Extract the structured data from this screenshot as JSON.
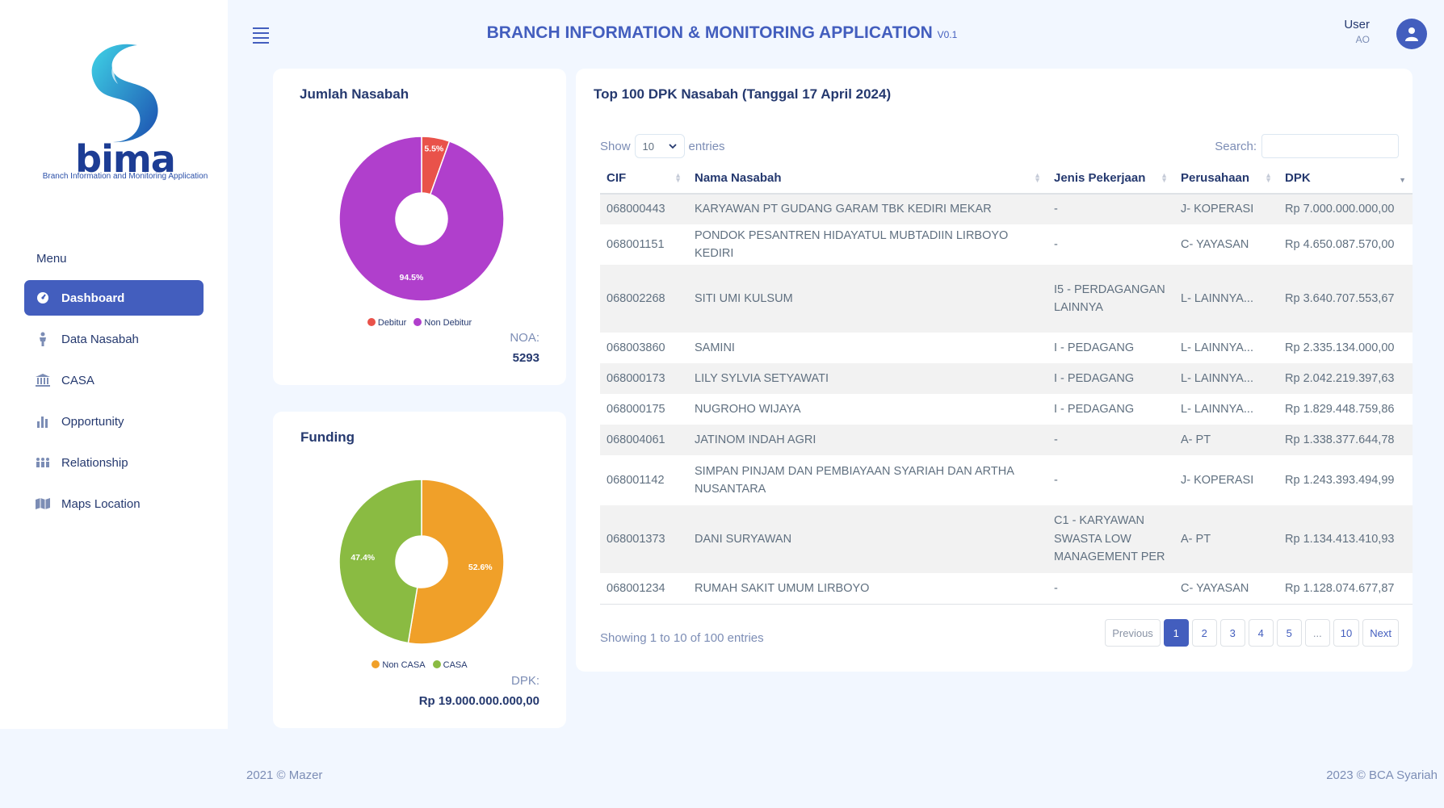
{
  "app": {
    "title": "BRANCH INFORMATION & MONITORING APPLICATION",
    "version": "V0.1"
  },
  "logo": {
    "word": "bima",
    "subtitle": "Branch Information and Monitoring Application"
  },
  "user": {
    "name": "User",
    "role": "AO"
  },
  "sidebar": {
    "menu_title": "Menu",
    "items": [
      {
        "label": "Dashboard",
        "icon": "dashboard-icon",
        "active": true
      },
      {
        "label": "Data Nasabah",
        "icon": "person-icon",
        "active": false
      },
      {
        "label": "CASA",
        "icon": "bank-icon",
        "active": false
      },
      {
        "label": "Opportunity",
        "icon": "bar-chart-icon",
        "active": false
      },
      {
        "label": "Relationship",
        "icon": "people-icon",
        "active": false
      },
      {
        "label": "Maps Location",
        "icon": "map-icon",
        "active": false
      }
    ]
  },
  "nasabah_card": {
    "title": "Jumlah Nasabah",
    "summary_label": "NOA:",
    "summary_value": "5293"
  },
  "funding_card": {
    "title": "Funding",
    "summary_label": "DPK:",
    "summary_value": "Rp 19.000.000.000,00"
  },
  "chart_data": [
    {
      "type": "pie",
      "donut": true,
      "categories": [
        "Debitur",
        "Non Debitur"
      ],
      "values": [
        5.5,
        94.5
      ],
      "data_labels": [
        "5.5%",
        "94.5%"
      ],
      "colors": [
        "#e9524a",
        "#b03fcc"
      ],
      "legend": "bottom"
    },
    {
      "type": "pie",
      "donut": true,
      "categories": [
        "Non CASA",
        "CASA"
      ],
      "values": [
        52.6,
        47.4
      ],
      "data_labels": [
        "52.6%",
        "47.4%"
      ],
      "colors": [
        "#f0a029",
        "#8abb42"
      ],
      "legend": "bottom"
    }
  ],
  "table": {
    "title": "Top 100 DPK Nasabah (Tanggal 17 April 2024)",
    "show_label": "Show",
    "entries_value": "10",
    "entries_label": "entries",
    "search_label": "Search:",
    "search_value": "",
    "columns": [
      "CIF",
      "Nama Nasabah",
      "Jenis Pekerjaan",
      "Perusahaan",
      "DPK"
    ],
    "rows": [
      [
        "068000443",
        "KARYAWAN PT GUDANG GARAM TBK KEDIRI MEKAR",
        "-",
        "J- KOPERASI",
        "Rp 7.000.000.000,00"
      ],
      [
        "068001151",
        "PONDOK PESANTREN HIDAYATUL MUBTADIIN LIRBOYO KEDIRI",
        "-",
        "C- YAYASAN",
        "Rp 4.650.087.570,00"
      ],
      [
        "068002268",
        "SITI UMI KULSUM",
        "I5 - PERDAGANGAN LAINNYA",
        "L- LAINNYA...",
        "Rp 3.640.707.553,67"
      ],
      [
        "068003860",
        "SAMINI",
        "I - PEDAGANG",
        "L- LAINNYA...",
        "Rp 2.335.134.000,00"
      ],
      [
        "068000173",
        "LILY SYLVIA SETYAWATI",
        "I - PEDAGANG",
        "L- LAINNYA...",
        "Rp 2.042.219.397,63"
      ],
      [
        "068000175",
        "NUGROHO WIJAYA",
        "I - PEDAGANG",
        "L- LAINNYA...",
        "Rp 1.829.448.759,86"
      ],
      [
        "068004061",
        "JATINOM INDAH AGRI",
        "-",
        "A- PT",
        "Rp 1.338.377.644,78"
      ],
      [
        "068001142",
        "SIMPAN PINJAM DAN PEMBIAYAAN SYARIAH DAN ARTHA NUSANTARA",
        "-",
        "J- KOPERASI",
        "Rp 1.243.393.494,99"
      ],
      [
        "068001373",
        "DANI SURYAWAN",
        "C1 - KARYAWAN SWASTA LOW MANAGEMENT PER",
        "A- PT",
        "Rp 1.134.413.410,93"
      ],
      [
        "068001234",
        "RUMAH SAKIT UMUM LIRBOYO",
        "-",
        "C- YAYASAN",
        "Rp 1.128.074.677,87"
      ]
    ],
    "showing_text": "Showing 1 to 10 of 100 entries",
    "pagination": [
      "Previous",
      "1",
      "2",
      "3",
      "4",
      "5",
      "...",
      "10",
      "Next"
    ],
    "active_page": "1"
  },
  "footer": {
    "left": "2021 © Mazer",
    "right": "2023 © BCA Syariah"
  }
}
